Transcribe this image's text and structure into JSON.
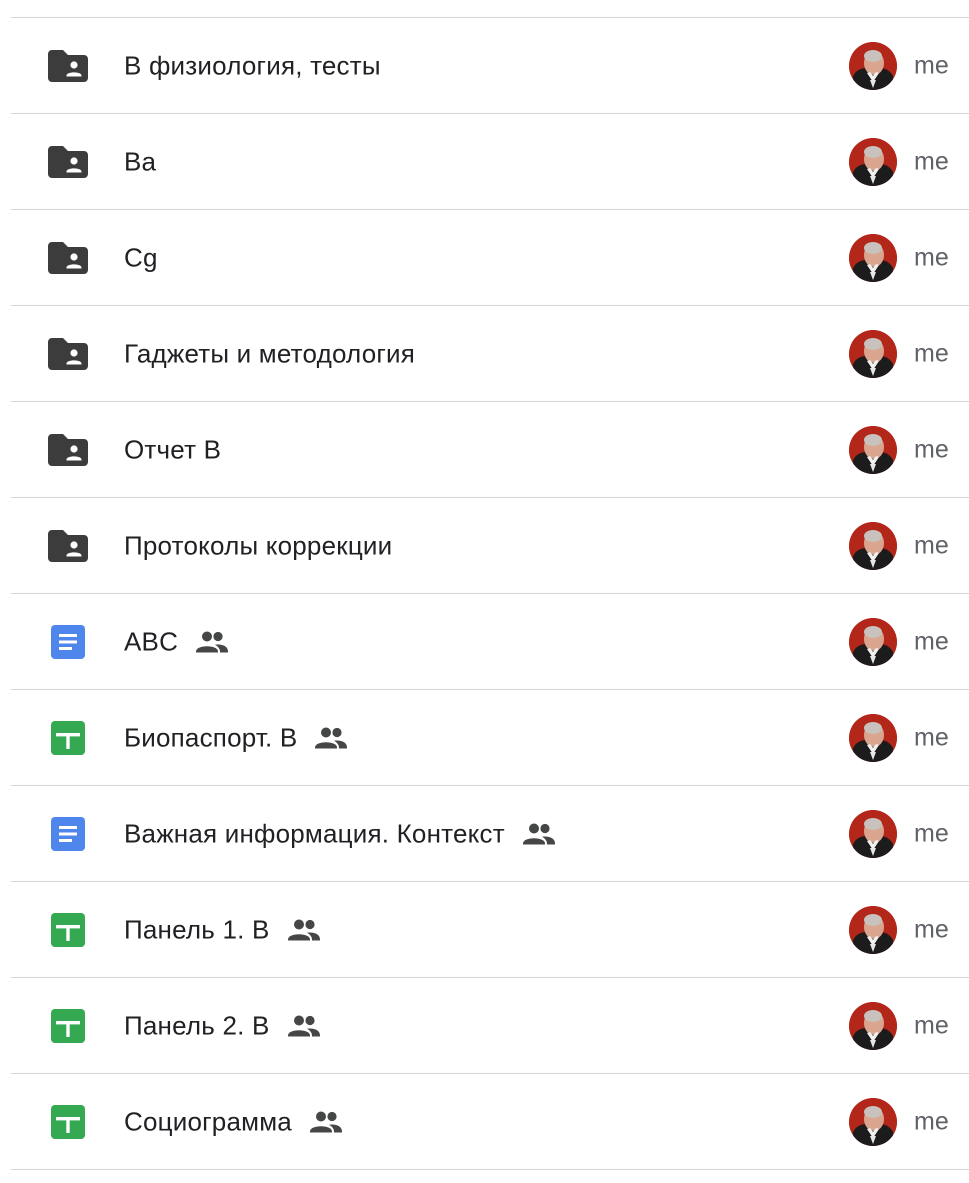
{
  "files": [
    {
      "name": "В физиология, тесты",
      "type": "shared-folder",
      "shared": false,
      "owner": "me"
    },
    {
      "name": "Ba",
      "type": "shared-folder",
      "shared": false,
      "owner": "me"
    },
    {
      "name": "Cg",
      "type": "shared-folder",
      "shared": false,
      "owner": "me"
    },
    {
      "name": "Гаджеты и методология",
      "type": "shared-folder",
      "shared": false,
      "owner": "me"
    },
    {
      "name": "Отчет В",
      "type": "shared-folder",
      "shared": false,
      "owner": "me"
    },
    {
      "name": "Протоколы коррекции",
      "type": "shared-folder",
      "shared": false,
      "owner": "me"
    },
    {
      "name": "ABC",
      "type": "doc",
      "shared": true,
      "owner": "me"
    },
    {
      "name": "Биопаспорт. В",
      "type": "sheet",
      "shared": true,
      "owner": "me"
    },
    {
      "name": "Важная информация. Контекст",
      "type": "doc",
      "shared": true,
      "owner": "me"
    },
    {
      "name": "Панель 1. В",
      "type": "sheet",
      "shared": true,
      "owner": "me"
    },
    {
      "name": "Панель 2. В",
      "type": "sheet",
      "shared": true,
      "owner": "me"
    },
    {
      "name": "Социограмма",
      "type": "sheet",
      "shared": true,
      "owner": "me"
    }
  ],
  "icons": {
    "shared-folder": "shared-folder-icon",
    "doc": "google-docs-icon",
    "sheet": "google-sheets-icon",
    "shared": "people-icon",
    "owner": "avatar"
  },
  "colors": {
    "folder": "#3c3c3c",
    "doc": "#4f86ec",
    "sheet": "#35a852",
    "shared_icon": "#444746",
    "owner_text": "#5f6368",
    "divider": "#d5d5d5"
  }
}
